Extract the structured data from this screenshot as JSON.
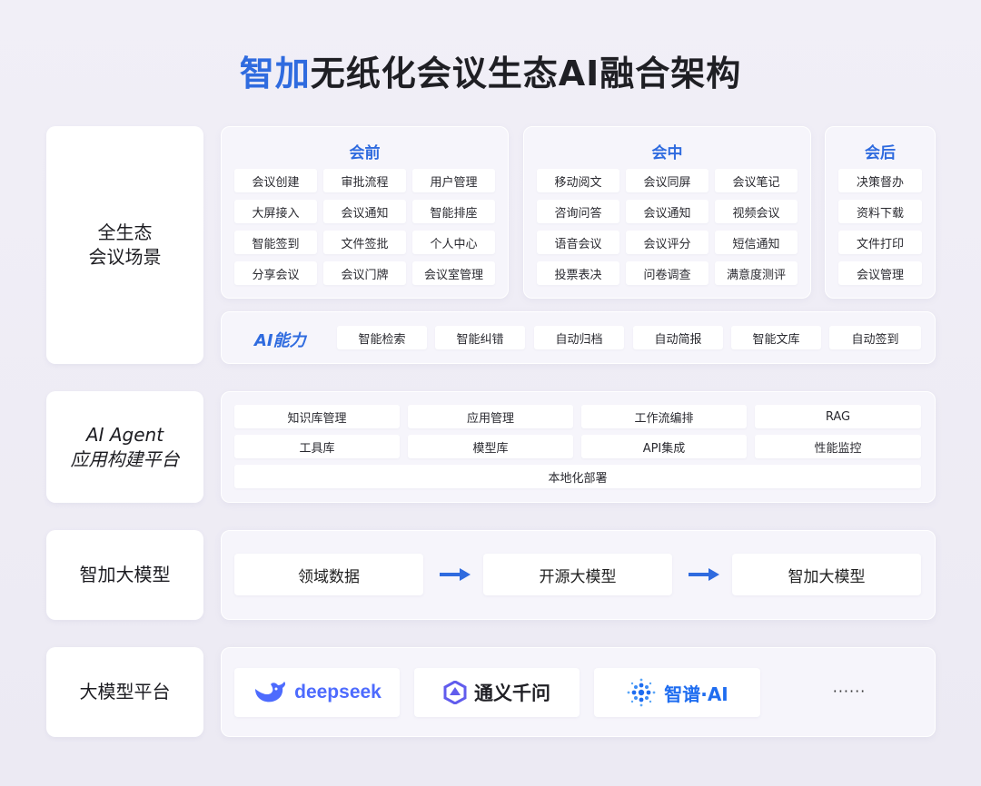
{
  "title": {
    "highlight": "智加",
    "rest": "无纸化会议生态AI融合架构"
  },
  "rows": {
    "scene": {
      "line1": "全生态",
      "line2": "会议场景"
    },
    "agent": {
      "line1": "AI Agent",
      "line2": "应用构建平台"
    },
    "model": {
      "label": "智加大模型"
    },
    "platform": {
      "label": "大模型平台"
    }
  },
  "before": {
    "title": "会前",
    "items": [
      "会议创建",
      "审批流程",
      "用户管理",
      "大屏接入",
      "会议通知",
      "智能排座",
      "智能签到",
      "文件签批",
      "个人中心",
      "分享会议",
      "会议门牌",
      "会议室管理"
    ]
  },
  "during": {
    "title": "会中",
    "items": [
      "移动阅文",
      "会议同屏",
      "会议笔记",
      "咨询问答",
      "会议通知",
      "视频会议",
      "语音会议",
      "会议评分",
      "短信通知",
      "投票表决",
      "问卷调查",
      "满意度测评"
    ]
  },
  "after": {
    "title": "会后",
    "items": [
      "决策督办",
      "资料下载",
      "文件打印",
      "会议管理"
    ]
  },
  "ai": {
    "label": "AI能力",
    "items": [
      "智能检索",
      "智能纠错",
      "自动归档",
      "自动简报",
      "智能文库",
      "自动签到"
    ]
  },
  "agent": {
    "items": [
      "知识库管理",
      "应用管理",
      "工作流编排",
      "RAG",
      "工具库",
      "模型库",
      "API集成",
      "性能监控"
    ],
    "wide": "本地化部署"
  },
  "model_flow": [
    "领域数据",
    "开源大模型",
    "智加大模型"
  ],
  "platforms": {
    "deepseek": "deepseek",
    "qwen": "通义千问",
    "zhipu": "智谱·AI",
    "more": "······"
  },
  "colors": {
    "accent": "#2f6bdf",
    "deepseek": "#4d6bfe",
    "qwen": "#615ced",
    "zhipu": "#1f6df0"
  }
}
